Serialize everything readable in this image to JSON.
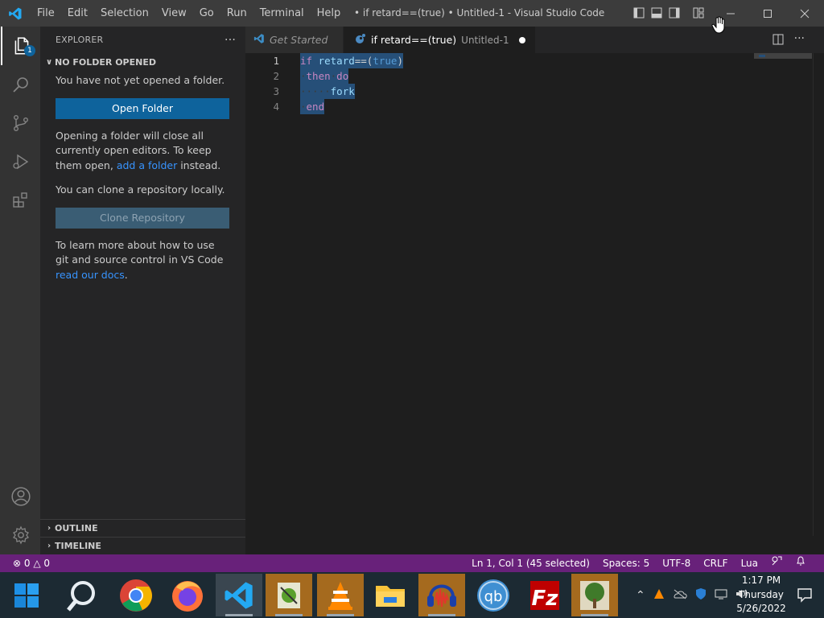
{
  "window": {
    "title": "• if retard==(true) • Untitled-1 - Visual Studio Code"
  },
  "menu": [
    "File",
    "Edit",
    "Selection",
    "View",
    "Go",
    "Run",
    "Terminal",
    "Help"
  ],
  "activity": {
    "explorer_badge": "1"
  },
  "sidebar": {
    "header": "EXPLORER",
    "more": "···",
    "section_title": "NO FOLDER OPENED",
    "no_folder_text": "You have not yet opened a folder.",
    "open_folder_button": "Open Folder",
    "opening_text_1": "Opening a folder will close all currently open editors. To keep them open, ",
    "add_folder_link": "add a folder",
    "opening_text_2": " instead.",
    "clone_text": "You can clone a repository locally.",
    "clone_button": "Clone Repository",
    "learn_text": "To learn more about how to use git and source control in VS Code ",
    "docs_link": "read our docs",
    "learn_end": ".",
    "outline": "OUTLINE",
    "timeline": "TIMELINE"
  },
  "tabs": [
    {
      "label": "Get Started",
      "active": false
    },
    {
      "label": "if retard==(true)",
      "description": "Untitled-1",
      "active": true,
      "dirty": true
    }
  ],
  "editor": {
    "lines": [
      {
        "number": "1",
        "tokens": [
          [
            "kw",
            "if"
          ],
          [
            "op",
            " "
          ],
          [
            "id",
            "retard"
          ],
          [
            "op",
            "==("
          ],
          [
            "bool",
            "true"
          ],
          [
            "op",
            ")"
          ]
        ]
      },
      {
        "number": "2",
        "tokens": [
          [
            "ws",
            "·"
          ],
          [
            "kw",
            "then"
          ],
          [
            "ws",
            "·"
          ],
          [
            "kw",
            "do"
          ]
        ]
      },
      {
        "number": "3",
        "tokens": [
          [
            "ws",
            "·····"
          ],
          [
            "id",
            "fork"
          ]
        ]
      },
      {
        "number": "4",
        "tokens": [
          [
            "ws",
            "·"
          ],
          [
            "kw",
            "end"
          ]
        ]
      }
    ]
  },
  "status": {
    "errors": "0",
    "warnings": "0",
    "position": "Ln 1, Col 1 (45 selected)",
    "spaces": "Spaces: 5",
    "encoding": "UTF-8",
    "eol": "CRLF",
    "language": "Lua"
  },
  "taskbar": {
    "apps": [
      "Start",
      "Search",
      "Chrome",
      "Firefox",
      "Visual Studio Code",
      "Notepad++",
      "VLC",
      "File Explorer",
      "Audacity",
      "qBittorrent",
      "FileZilla",
      "Tree app"
    ],
    "time": "1:17 PM",
    "day": "Thursday",
    "date": "5/26/2022"
  },
  "colors": {
    "statusbar": "#68217a",
    "accent": "#0e639c",
    "selection": "#264f78"
  }
}
